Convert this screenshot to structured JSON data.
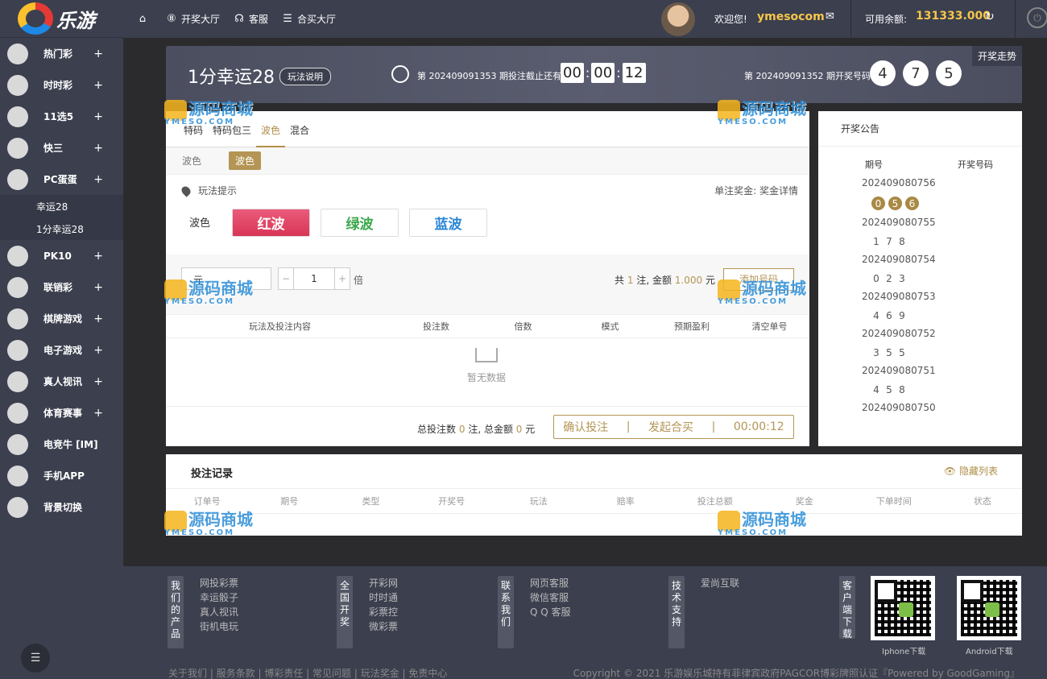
{
  "brand": {
    "name": "乐游"
  },
  "sidebar": {
    "items": [
      {
        "label": "热门彩",
        "icon": "hot"
      },
      {
        "label": "时时彩",
        "icon": "ssc"
      },
      {
        "label": "11选5",
        "icon": "11x5"
      },
      {
        "label": "快三",
        "icon": "dice"
      },
      {
        "label": "PC蛋蛋",
        "icon": "pcdd"
      }
    ],
    "sub_items": [
      {
        "label": "幸运28"
      },
      {
        "label": "1分幸运28"
      }
    ],
    "items2": [
      {
        "label": "PK10",
        "icon": "pk"
      },
      {
        "label": "联销彩",
        "icon": "dots"
      },
      {
        "label": "棋牌游戏",
        "icon": "cards"
      },
      {
        "label": "电子游戏",
        "icon": "slot"
      },
      {
        "label": "真人视讯",
        "icon": "person"
      },
      {
        "label": "体育赛事",
        "icon": "ball"
      },
      {
        "label": "电竞牛 [IM]",
        "icon": "bull"
      },
      {
        "label": "手机APP",
        "icon": "phone"
      },
      {
        "label": "背景切换",
        "icon": "monitor"
      }
    ],
    "plus": "+"
  },
  "topbar": {
    "nav": [
      {
        "label": "开奖大厅"
      },
      {
        "label": "客服"
      },
      {
        "label": "合买大厅"
      }
    ],
    "welcome": "欢迎您!",
    "username": "ymesocom",
    "balance_label": "可用余额:",
    "balance": "131333.000"
  },
  "game": {
    "title": "1分幸运28",
    "rules": "玩法说明",
    "issue_prefix": "第",
    "current_issue": "202409091353",
    "cd_label": "期投注截止还有",
    "countdown": [
      "00",
      "00",
      "12"
    ],
    "last_issue": "202409091352",
    "result_label": "期开奖号码",
    "result": [
      "4",
      "7",
      "5"
    ],
    "trend": "开奖走势"
  },
  "tabs": [
    {
      "label": "特码"
    },
    {
      "label": "特码包三"
    },
    {
      "label": "波色"
    },
    {
      "label": "混合"
    }
  ],
  "subtabs": [
    {
      "label": "波色"
    },
    {
      "label": "波色"
    }
  ],
  "play": {
    "tip": "玩法提示",
    "prize_label": "单注奖金:",
    "prize_detail": "奖金详情",
    "bo_label": "波色",
    "red": "红波",
    "green": "绿波",
    "blue": "蓝波"
  },
  "bet": {
    "mode_char": "元",
    "multiple": "1",
    "mult_label": "倍",
    "sum_prefix": "共",
    "count": "1",
    "sum_mid": "注, 金额",
    "amount": "1.000",
    "unit": "元",
    "add": "添加号码"
  },
  "bet_table": {
    "headers": [
      "玩法及投注内容",
      "投注数",
      "倍数",
      "模式",
      "预期盈利",
      "清空单号"
    ],
    "empty": "暂无数据"
  },
  "total": {
    "prefix": "总投注数",
    "count": "0",
    "mid": "注,  总金额",
    "amount": "0",
    "unit": "元",
    "confirm": "确认投注",
    "sep": "|",
    "group": "发起合买",
    "timer": "00:00:12"
  },
  "notice": {
    "title": "开奖公告",
    "col_issue": "期号",
    "col_number": "开奖号码",
    "rows": [
      {
        "issue": "202409080756",
        "nums": [
          "0",
          "5",
          "6"
        ],
        "ball": true
      },
      {
        "issue": "202409080755",
        "nums": [
          "1",
          "7",
          "8"
        ],
        "ball": false
      },
      {
        "issue": "202409080754",
        "nums": [
          "0",
          "2",
          "3"
        ],
        "ball": false
      },
      {
        "issue": "202409080753",
        "nums": [
          "4",
          "6",
          "9"
        ],
        "ball": false
      },
      {
        "issue": "202409080752",
        "nums": [
          "3",
          "5",
          "5"
        ],
        "ball": false
      },
      {
        "issue": "202409080751",
        "nums": [
          "4",
          "5",
          "8"
        ],
        "ball": false
      },
      {
        "issue": "202409080750",
        "nums": [],
        "ball": false
      }
    ]
  },
  "records": {
    "title": "投注记录",
    "hide": "隐藏列表",
    "headers": [
      "订单号",
      "期号",
      "类型",
      "开奖号",
      "玩法",
      "赔率",
      "投注总额",
      "奖金",
      "下单时间",
      "状态"
    ]
  },
  "watermark": {
    "text": "源码商城",
    "sub": "YMESO.COM"
  },
  "footer": {
    "cols": [
      {
        "tag": "我们的产品",
        "links": [
          "网投彩票",
          "幸运骰子",
          "真人视讯",
          "街机电玩"
        ]
      },
      {
        "tag": "全国开奖",
        "links": [
          "开彩网",
          "时时通",
          "彩票控",
          "微彩票"
        ]
      },
      {
        "tag": "联系我们",
        "links": [
          "网页客服",
          "微信客服",
          "Q Q 客服"
        ]
      },
      {
        "tag": "技术支持",
        "links": [
          "爱尚互联"
        ]
      },
      {
        "tag": "客户端下载",
        "links": []
      }
    ],
    "iphone": "Iphone下载",
    "android": "Android下载",
    "bottom_links": "关于我们 | 服务条款 | 博彩责任 | 常见问题 | 玩法奖金 | 免责中心",
    "copyright": "Copyright © 2021 乐游娱乐城持有菲律宾政府PAGCOR博彩牌照认证『Powered by GoodGaming』"
  }
}
